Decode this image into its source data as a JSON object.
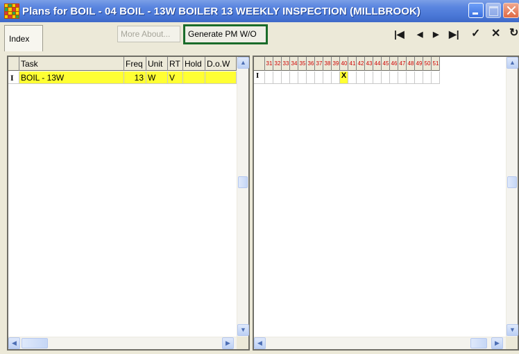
{
  "window": {
    "title": "Plans for BOIL - 04 BOIL - 13W BOILER 13 WEEKLY INSPECTION (MILLBROOK)",
    "icon": "app-grid-icon",
    "controls": [
      "minimize-icon",
      "maximize-icon",
      "close-icon"
    ]
  },
  "toolbar": {
    "index_tab": "Index",
    "more_about_label": "More About...",
    "generate_label": "Generate PM W/O",
    "nav_icons": [
      {
        "name": "first-record-icon",
        "glyph": "⏮"
      },
      {
        "name": "prev-record-icon",
        "glyph": "◀"
      },
      {
        "name": "next-record-icon",
        "glyph": "▶"
      },
      {
        "name": "last-record-icon",
        "glyph": "⏭"
      },
      {
        "name": "confirm-check-icon",
        "glyph": "✔"
      },
      {
        "name": "cancel-x-icon",
        "glyph": "✖"
      },
      {
        "name": "refresh-icon",
        "glyph": "↻"
      }
    ]
  },
  "task_grid": {
    "columns": [
      "",
      "Task",
      "Freq",
      "Unit",
      "RT",
      "Hold",
      "D.o.W"
    ],
    "rows": [
      {
        "indicator": "I",
        "task": "BOIL - 13W",
        "freq": "13",
        "unit": "W",
        "rt": "V",
        "hold": "",
        "dow": ""
      }
    ]
  },
  "week_grid": {
    "weeks": [
      "31",
      "32",
      "33",
      "34",
      "35",
      "36",
      "37",
      "38",
      "39",
      "40",
      "41",
      "42",
      "43",
      "44",
      "45",
      "46",
      "47",
      "48",
      "49",
      "50",
      "51"
    ],
    "rows": [
      {
        "indicator": "I",
        "marks": [
          "",
          "",
          "",
          "",
          "",
          "",
          "",
          "",
          "",
          "X",
          "",
          "",
          "",
          "",
          "",
          "",
          "",
          "",
          "",
          "",
          ""
        ]
      }
    ]
  },
  "colors": {
    "highlight": "#ffff33",
    "week_number": "#cc0000",
    "generate_border": "#1a6b2a",
    "titlebar": "#4a77d6"
  }
}
